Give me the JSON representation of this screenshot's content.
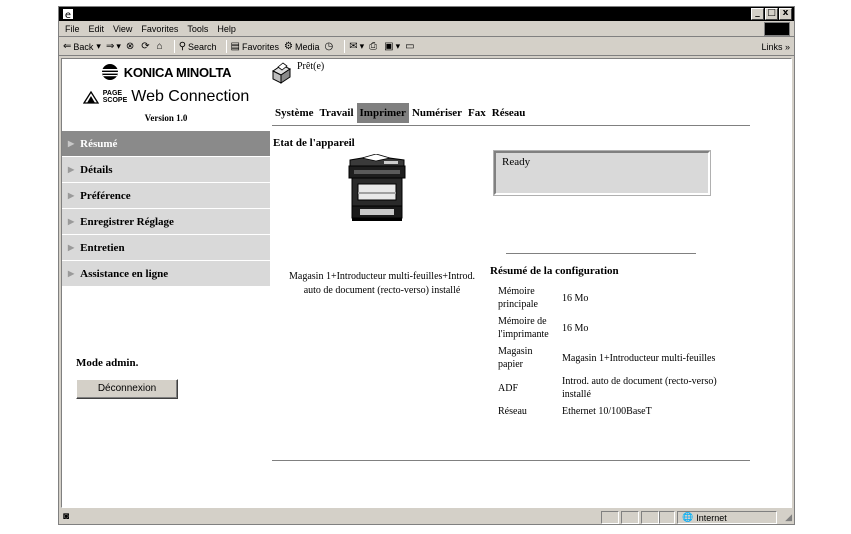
{
  "window": {
    "controls": [
      "_",
      "□",
      "x"
    ]
  },
  "menu": [
    "File",
    "Edit",
    "View",
    "Favorites",
    "Tools",
    "Help"
  ],
  "toolbar": {
    "back": "Back",
    "search": "Search",
    "favorites": "Favorites",
    "media": "Media",
    "links": "Links »"
  },
  "brand": {
    "company": "KONICA MINOLTA",
    "page_scope_top": "PAGE",
    "page_scope_bottom": "SCOPE",
    "product": "Web Connection",
    "version": "Version 1.0"
  },
  "nav": [
    {
      "label": "Résumé",
      "active": true
    },
    {
      "label": "Détails",
      "active": false
    },
    {
      "label": "Préférence",
      "active": false
    },
    {
      "label": "Enregistrer Réglage",
      "active": false
    },
    {
      "label": "Entretien",
      "active": false
    },
    {
      "label": "Assistance en ligne",
      "active": false
    }
  ],
  "admin": {
    "label": "Mode admin.",
    "logout": "Déconnexion"
  },
  "device_status": {
    "label": "Prêt(e)"
  },
  "tabs": [
    {
      "label": "Système",
      "active": false
    },
    {
      "label": "Travail",
      "active": false
    },
    {
      "label": "Imprimer",
      "active": true
    },
    {
      "label": "Numériser",
      "active": false
    },
    {
      "label": "Fax",
      "active": false
    },
    {
      "label": "Réseau",
      "active": false
    }
  ],
  "main": {
    "section_title": "Etat de l'appareil",
    "device_caption": "Magasin 1+Introducteur multi-feuilles+Introd. auto de document (recto-verso) installé",
    "status_message": "Ready",
    "config_title": "Résumé de la configuration",
    "config": [
      {
        "key": "Mémoire principale",
        "value": "16 Mo"
      },
      {
        "key": "Mémoire de l'imprimante",
        "value": "16 Mo"
      },
      {
        "key": "Magasin papier",
        "value": "Magasin 1+Introducteur multi-feuilles"
      },
      {
        "key": "ADF",
        "value": "Introd. auto de document (recto-verso) installé"
      },
      {
        "key": "Réseau",
        "value": "Ethernet 10/100BaseT"
      }
    ]
  },
  "statusbar": {
    "zone": "Internet"
  },
  "colors": {
    "active_nav": "#8a8a8a",
    "nav_bg": "#d9d9d9",
    "active_tab": "#808080",
    "status_box": "#d9d9d9"
  }
}
